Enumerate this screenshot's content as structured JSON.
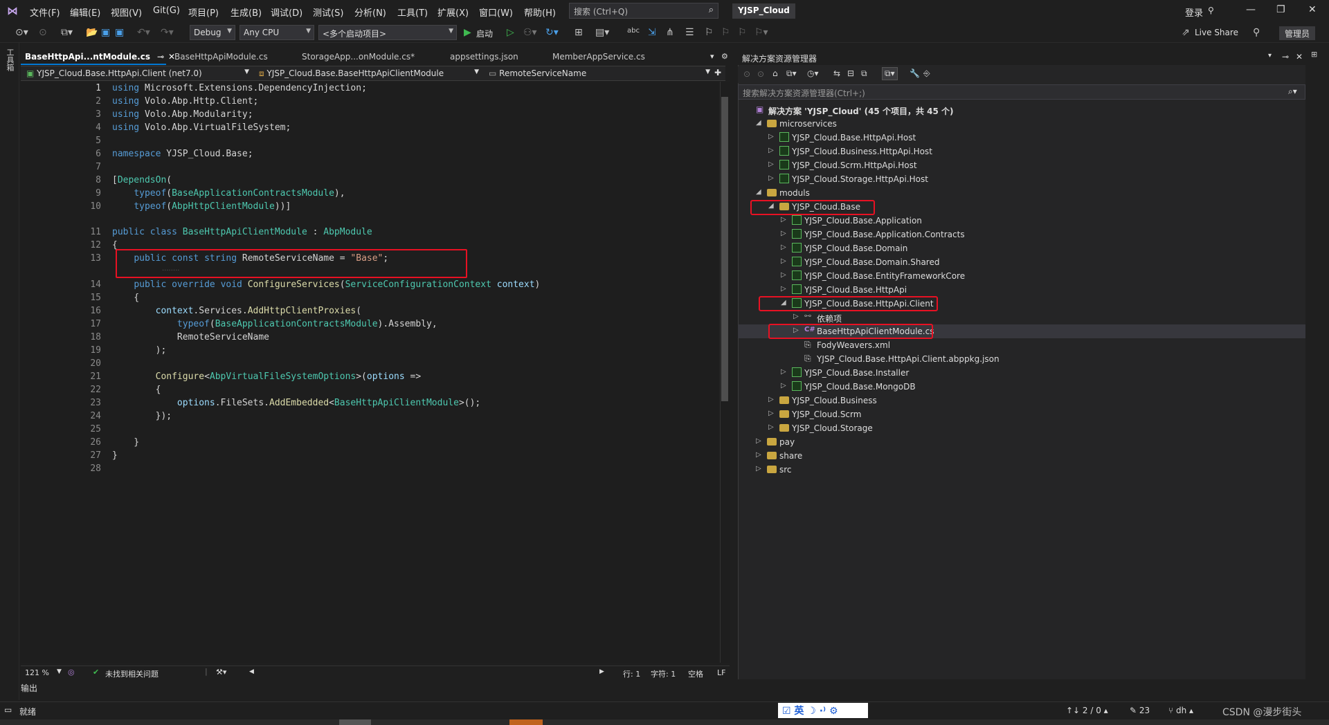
{
  "menu": [
    "文件(F)",
    "编辑(E)",
    "视图(V)",
    "Git(G)",
    "项目(P)",
    "生成(B)",
    "调试(D)",
    "测试(S)",
    "分析(N)",
    "工具(T)",
    "扩展(X)",
    "窗口(W)",
    "帮助(H)"
  ],
  "search_placeholder": "搜索 (Ctrl+Q)",
  "solution_name": "YJSP_Cloud",
  "login_label": "登录",
  "live_share": "Live Share",
  "admin_label": "管理员",
  "toolbar": {
    "config": "Debug",
    "platform": "Any CPU",
    "startup": "<多个启动项目>",
    "run": "启动"
  },
  "left_strip_label": "工具箱",
  "tabs": [
    "BaseHttpApi...ntModule.cs",
    "BaseHttpApiModule.cs",
    "StorageApp...onModule.cs*",
    "appsettings.json",
    "MemberAppService.cs"
  ],
  "nav": {
    "project": "YJSP_Cloud.Base.HttpApi.Client (net7.0)",
    "class": "YJSP_Cloud.Base.BaseHttpApiClientModule",
    "member": "RemoteServiceName"
  },
  "code": [
    {
      "n": "1",
      "t": "using Microsoft.Extensions.DependencyInjection;"
    },
    {
      "n": "2",
      "t": "using Volo.Abp.Http.Client;"
    },
    {
      "n": "3",
      "t": "using Volo.Abp.Modularity;"
    },
    {
      "n": "4",
      "t": "using Volo.Abp.VirtualFileSystem;"
    },
    {
      "n": "5",
      "t": ""
    },
    {
      "n": "6",
      "t": "namespace YJSP_Cloud.Base;"
    },
    {
      "n": "7",
      "t": ""
    },
    {
      "n": "8",
      "t": "[DependsOn("
    },
    {
      "n": "9",
      "t": "    typeof(BaseApplicationContractsModule),"
    },
    {
      "n": "10",
      "t": "    typeof(AbpHttpClientModule))]"
    },
    {
      "n": "11",
      "t": "public class BaseHttpApiClientModule : AbpModule"
    },
    {
      "n": "12",
      "t": "{"
    },
    {
      "n": "13",
      "t": "    public const string RemoteServiceName = \"Base\";"
    },
    {
      "n": "14",
      "t": "    public override void ConfigureServices(ServiceConfigurationContext context)"
    },
    {
      "n": "15",
      "t": "    {"
    },
    {
      "n": "16",
      "t": "        context.Services.AddHttpClientProxies("
    },
    {
      "n": "17",
      "t": "            typeof(BaseApplicationContractsModule).Assembly,"
    },
    {
      "n": "18",
      "t": "            RemoteServiceName"
    },
    {
      "n": "19",
      "t": "        );"
    },
    {
      "n": "20",
      "t": ""
    },
    {
      "n": "21",
      "t": "        Configure<AbpVirtualFileSystemOptions>(options =>"
    },
    {
      "n": "22",
      "t": "        {"
    },
    {
      "n": "23",
      "t": "            options.FileSets.AddEmbedded<BaseHttpApiClientModule>();"
    },
    {
      "n": "24",
      "t": "        });"
    },
    {
      "n": "25",
      "t": ""
    },
    {
      "n": "26",
      "t": "    }"
    },
    {
      "n": "27",
      "t": "}"
    },
    {
      "n": "28",
      "t": ""
    }
  ],
  "editor_status": {
    "zoom": "121 %",
    "issues": "未找到相关问题",
    "line": "行: 1",
    "col": "字符: 1",
    "space": "空格",
    "eol": "LF"
  },
  "output_tab": "输出",
  "se": {
    "title": "解决方案资源管理器",
    "search": "搜索解决方案资源管理器(Ctrl+;)",
    "tree": [
      {
        "label": "解决方案 'YJSP_Cloud' (45 个项目，共 45 个)",
        "depth": 0,
        "type": "solution",
        "arrow": ""
      },
      {
        "label": "microservices",
        "depth": 1,
        "type": "folder",
        "arrow": "◢"
      },
      {
        "label": "YJSP_Cloud.Base.HttpApi.Host",
        "depth": 2,
        "type": "web",
        "arrow": "▷"
      },
      {
        "label": "YJSP_Cloud.Business.HttpApi.Host",
        "depth": 2,
        "type": "web",
        "arrow": "▷"
      },
      {
        "label": "YJSP_Cloud.Scrm.HttpApi.Host",
        "depth": 2,
        "type": "web",
        "arrow": "▷"
      },
      {
        "label": "YJSP_Cloud.Storage.HttpApi.Host",
        "depth": 2,
        "type": "web",
        "arrow": "▷"
      },
      {
        "label": "moduls",
        "depth": 1,
        "type": "folder",
        "arrow": "◢"
      },
      {
        "label": "YJSP_Cloud.Base",
        "depth": 2,
        "type": "folder",
        "arrow": "◢"
      },
      {
        "label": "YJSP_Cloud.Base.Application",
        "depth": 3,
        "type": "proj",
        "arrow": "▷"
      },
      {
        "label": "YJSP_Cloud.Base.Application.Contracts",
        "depth": 3,
        "type": "proj",
        "arrow": "▷"
      },
      {
        "label": "YJSP_Cloud.Base.Domain",
        "depth": 3,
        "type": "proj",
        "arrow": "▷"
      },
      {
        "label": "YJSP_Cloud.Base.Domain.Shared",
        "depth": 3,
        "type": "proj",
        "arrow": "▷"
      },
      {
        "label": "YJSP_Cloud.Base.EntityFrameworkCore",
        "depth": 3,
        "type": "proj",
        "arrow": "▷"
      },
      {
        "label": "YJSP_Cloud.Base.HttpApi",
        "depth": 3,
        "type": "proj",
        "arrow": "▷"
      },
      {
        "label": "YJSP_Cloud.Base.HttpApi.Client",
        "depth": 3,
        "type": "proj",
        "arrow": "◢"
      },
      {
        "label": "依赖项",
        "depth": 4,
        "type": "dep",
        "arrow": "▷"
      },
      {
        "label": "BaseHttpApiClientModule.cs",
        "depth": 4,
        "type": "cs",
        "arrow": "▷"
      },
      {
        "label": "FodyWeavers.xml",
        "depth": 4,
        "type": "file",
        "arrow": ""
      },
      {
        "label": "YJSP_Cloud.Base.HttpApi.Client.abppkg.json",
        "depth": 4,
        "type": "file",
        "arrow": ""
      },
      {
        "label": "YJSP_Cloud.Base.Installer",
        "depth": 3,
        "type": "proj",
        "arrow": "▷"
      },
      {
        "label": "YJSP_Cloud.Base.MongoDB",
        "depth": 3,
        "type": "proj",
        "arrow": "▷"
      },
      {
        "label": "YJSP_Cloud.Business",
        "depth": 2,
        "type": "folder",
        "arrow": "▷"
      },
      {
        "label": "YJSP_Cloud.Scrm",
        "depth": 2,
        "type": "folder",
        "arrow": "▷"
      },
      {
        "label": "YJSP_Cloud.Storage",
        "depth": 2,
        "type": "folder",
        "arrow": "▷"
      },
      {
        "label": "pay",
        "depth": 1,
        "type": "folder",
        "arrow": "▷"
      },
      {
        "label": "share",
        "depth": 1,
        "type": "folder",
        "arrow": "▷"
      },
      {
        "label": "src",
        "depth": 1,
        "type": "folder",
        "arrow": "▷"
      }
    ]
  },
  "status": {
    "ready": "就绪",
    "updown": "↑↓ 2 / 0 ▴",
    "edits": "✎ 23",
    "branch": "dh ▴",
    "watermark": "CSDN @漫步街头"
  },
  "ime": "☑ 英 ☽ ·⁾ ⚙"
}
